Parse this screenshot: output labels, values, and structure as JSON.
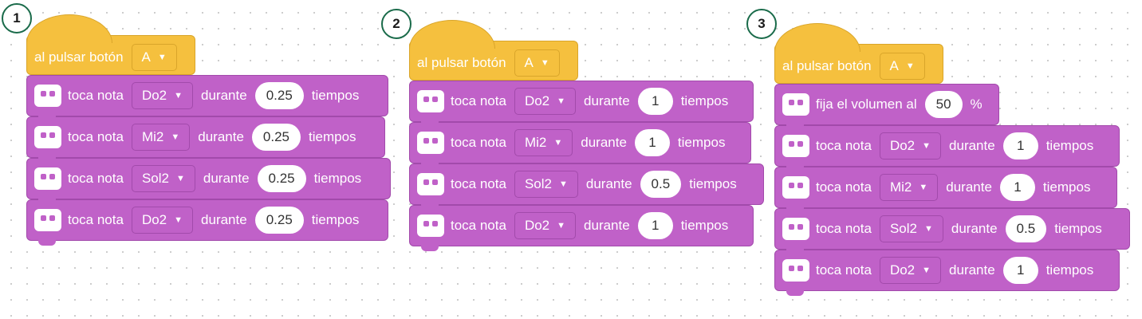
{
  "scripts": [
    {
      "badge": "1",
      "hat": {
        "label": "al pulsar botón",
        "button": "A"
      },
      "blocks": [
        {
          "type": "note",
          "label": "toca nota",
          "note": "Do2",
          "during": "durante",
          "value": "0.25",
          "unit": "tiempos"
        },
        {
          "type": "note",
          "label": "toca nota",
          "note": "Mi2",
          "during": "durante",
          "value": "0.25",
          "unit": "tiempos"
        },
        {
          "type": "note",
          "label": "toca nota",
          "note": "Sol2",
          "during": "durante",
          "value": "0.25",
          "unit": "tiempos"
        },
        {
          "type": "note",
          "label": "toca nota",
          "note": "Do2",
          "during": "durante",
          "value": "0.25",
          "unit": "tiempos"
        }
      ]
    },
    {
      "badge": "2",
      "hat": {
        "label": "al pulsar botón",
        "button": "A"
      },
      "blocks": [
        {
          "type": "note",
          "label": "toca nota",
          "note": "Do2",
          "during": "durante",
          "value": "1",
          "unit": "tiempos"
        },
        {
          "type": "note",
          "label": "toca nota",
          "note": "Mi2",
          "during": "durante",
          "value": "1",
          "unit": "tiempos"
        },
        {
          "type": "note",
          "label": "toca nota",
          "note": "Sol2",
          "during": "durante",
          "value": "0.5",
          "unit": "tiempos"
        },
        {
          "type": "note",
          "label": "toca nota",
          "note": "Do2",
          "during": "durante",
          "value": "1",
          "unit": "tiempos"
        }
      ]
    },
    {
      "badge": "3",
      "hat": {
        "label": "al pulsar botón",
        "button": "A"
      },
      "blocks": [
        {
          "type": "volume",
          "label": "fija el volumen al",
          "value": "50",
          "unit": "%"
        },
        {
          "type": "note",
          "label": "toca nota",
          "note": "Do2",
          "during": "durante",
          "value": "1",
          "unit": "tiempos"
        },
        {
          "type": "note",
          "label": "toca nota",
          "note": "Mi2",
          "during": "durante",
          "value": "1",
          "unit": "tiempos"
        },
        {
          "type": "note",
          "label": "toca nota",
          "note": "Sol2",
          "during": "durante",
          "value": "0.5",
          "unit": "tiempos"
        },
        {
          "type": "note",
          "label": "toca nota",
          "note": "Do2",
          "during": "durante",
          "value": "1",
          "unit": "tiempos"
        }
      ]
    }
  ],
  "colors": {
    "event_block": "#f5c03e",
    "sound_block": "#c061c8",
    "badge_border": "#1a6b4a"
  },
  "icons": {
    "dropdown": "triangle-down-icon",
    "block": "robot-face-icon"
  }
}
